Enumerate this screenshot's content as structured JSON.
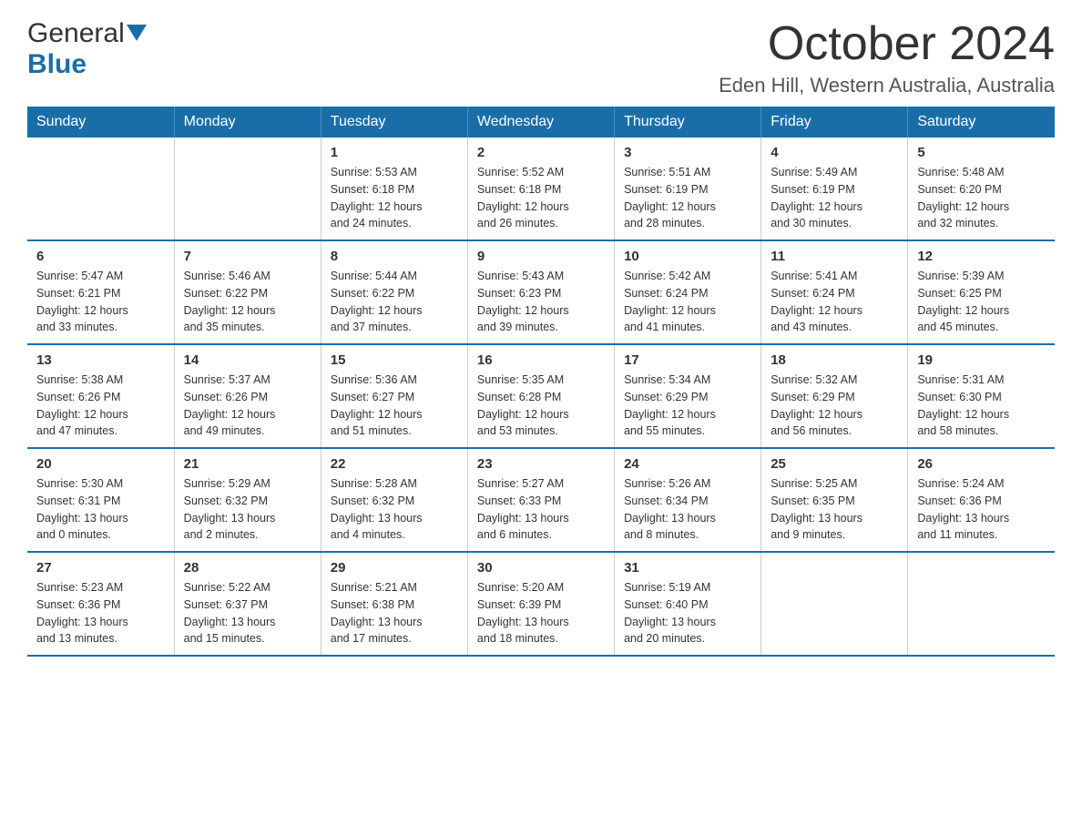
{
  "header": {
    "title": "October 2024",
    "location": "Eden Hill, Western Australia, Australia",
    "logo_general": "General",
    "logo_blue": "Blue"
  },
  "days_of_week": [
    "Sunday",
    "Monday",
    "Tuesday",
    "Wednesday",
    "Thursday",
    "Friday",
    "Saturday"
  ],
  "weeks": [
    [
      {
        "day": "",
        "info": ""
      },
      {
        "day": "",
        "info": ""
      },
      {
        "day": "1",
        "info": "Sunrise: 5:53 AM\nSunset: 6:18 PM\nDaylight: 12 hours\nand 24 minutes."
      },
      {
        "day": "2",
        "info": "Sunrise: 5:52 AM\nSunset: 6:18 PM\nDaylight: 12 hours\nand 26 minutes."
      },
      {
        "day": "3",
        "info": "Sunrise: 5:51 AM\nSunset: 6:19 PM\nDaylight: 12 hours\nand 28 minutes."
      },
      {
        "day": "4",
        "info": "Sunrise: 5:49 AM\nSunset: 6:19 PM\nDaylight: 12 hours\nand 30 minutes."
      },
      {
        "day": "5",
        "info": "Sunrise: 5:48 AM\nSunset: 6:20 PM\nDaylight: 12 hours\nand 32 minutes."
      }
    ],
    [
      {
        "day": "6",
        "info": "Sunrise: 5:47 AM\nSunset: 6:21 PM\nDaylight: 12 hours\nand 33 minutes."
      },
      {
        "day": "7",
        "info": "Sunrise: 5:46 AM\nSunset: 6:22 PM\nDaylight: 12 hours\nand 35 minutes."
      },
      {
        "day": "8",
        "info": "Sunrise: 5:44 AM\nSunset: 6:22 PM\nDaylight: 12 hours\nand 37 minutes."
      },
      {
        "day": "9",
        "info": "Sunrise: 5:43 AM\nSunset: 6:23 PM\nDaylight: 12 hours\nand 39 minutes."
      },
      {
        "day": "10",
        "info": "Sunrise: 5:42 AM\nSunset: 6:24 PM\nDaylight: 12 hours\nand 41 minutes."
      },
      {
        "day": "11",
        "info": "Sunrise: 5:41 AM\nSunset: 6:24 PM\nDaylight: 12 hours\nand 43 minutes."
      },
      {
        "day": "12",
        "info": "Sunrise: 5:39 AM\nSunset: 6:25 PM\nDaylight: 12 hours\nand 45 minutes."
      }
    ],
    [
      {
        "day": "13",
        "info": "Sunrise: 5:38 AM\nSunset: 6:26 PM\nDaylight: 12 hours\nand 47 minutes."
      },
      {
        "day": "14",
        "info": "Sunrise: 5:37 AM\nSunset: 6:26 PM\nDaylight: 12 hours\nand 49 minutes."
      },
      {
        "day": "15",
        "info": "Sunrise: 5:36 AM\nSunset: 6:27 PM\nDaylight: 12 hours\nand 51 minutes."
      },
      {
        "day": "16",
        "info": "Sunrise: 5:35 AM\nSunset: 6:28 PM\nDaylight: 12 hours\nand 53 minutes."
      },
      {
        "day": "17",
        "info": "Sunrise: 5:34 AM\nSunset: 6:29 PM\nDaylight: 12 hours\nand 55 minutes."
      },
      {
        "day": "18",
        "info": "Sunrise: 5:32 AM\nSunset: 6:29 PM\nDaylight: 12 hours\nand 56 minutes."
      },
      {
        "day": "19",
        "info": "Sunrise: 5:31 AM\nSunset: 6:30 PM\nDaylight: 12 hours\nand 58 minutes."
      }
    ],
    [
      {
        "day": "20",
        "info": "Sunrise: 5:30 AM\nSunset: 6:31 PM\nDaylight: 13 hours\nand 0 minutes."
      },
      {
        "day": "21",
        "info": "Sunrise: 5:29 AM\nSunset: 6:32 PM\nDaylight: 13 hours\nand 2 minutes."
      },
      {
        "day": "22",
        "info": "Sunrise: 5:28 AM\nSunset: 6:32 PM\nDaylight: 13 hours\nand 4 minutes."
      },
      {
        "day": "23",
        "info": "Sunrise: 5:27 AM\nSunset: 6:33 PM\nDaylight: 13 hours\nand 6 minutes."
      },
      {
        "day": "24",
        "info": "Sunrise: 5:26 AM\nSunset: 6:34 PM\nDaylight: 13 hours\nand 8 minutes."
      },
      {
        "day": "25",
        "info": "Sunrise: 5:25 AM\nSunset: 6:35 PM\nDaylight: 13 hours\nand 9 minutes."
      },
      {
        "day": "26",
        "info": "Sunrise: 5:24 AM\nSunset: 6:36 PM\nDaylight: 13 hours\nand 11 minutes."
      }
    ],
    [
      {
        "day": "27",
        "info": "Sunrise: 5:23 AM\nSunset: 6:36 PM\nDaylight: 13 hours\nand 13 minutes."
      },
      {
        "day": "28",
        "info": "Sunrise: 5:22 AM\nSunset: 6:37 PM\nDaylight: 13 hours\nand 15 minutes."
      },
      {
        "day": "29",
        "info": "Sunrise: 5:21 AM\nSunset: 6:38 PM\nDaylight: 13 hours\nand 17 minutes."
      },
      {
        "day": "30",
        "info": "Sunrise: 5:20 AM\nSunset: 6:39 PM\nDaylight: 13 hours\nand 18 minutes."
      },
      {
        "day": "31",
        "info": "Sunrise: 5:19 AM\nSunset: 6:40 PM\nDaylight: 13 hours\nand 20 minutes."
      },
      {
        "day": "",
        "info": ""
      },
      {
        "day": "",
        "info": ""
      }
    ]
  ],
  "colors": {
    "header_bg": "#1a6ea8",
    "header_text": "#ffffff",
    "border": "#1a6ea8",
    "text": "#333333",
    "blue": "#1a6ea8"
  }
}
